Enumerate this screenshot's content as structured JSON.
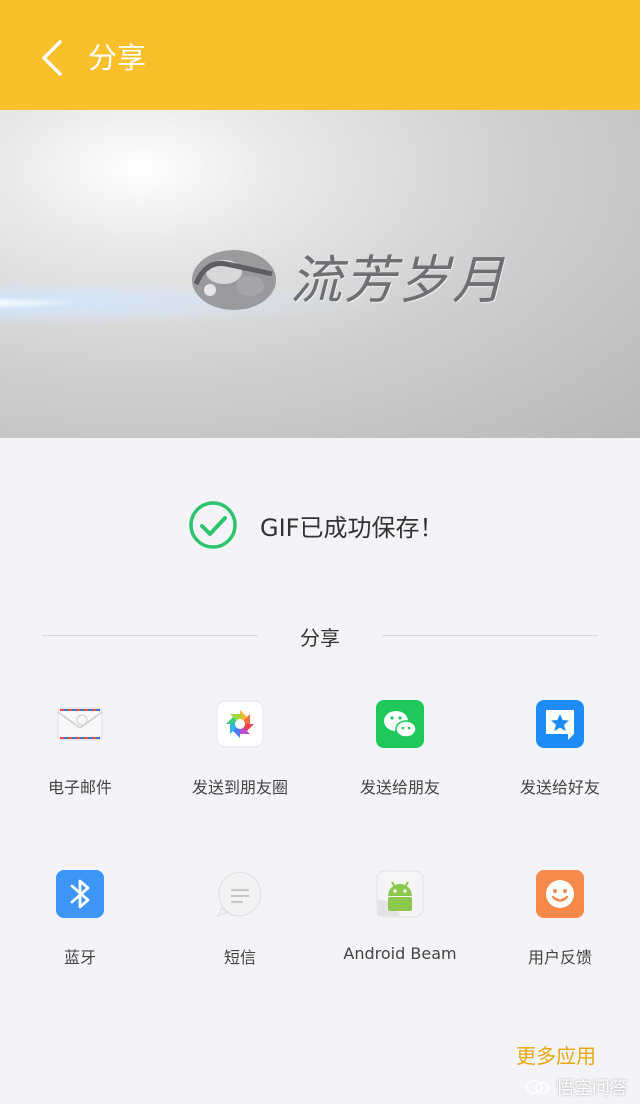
{
  "header": {
    "title": "分享",
    "background": "#f9c02c"
  },
  "preview": {
    "logo_text": "流芳岁月"
  },
  "status": {
    "message": "GIF已成功保存！",
    "check_color": "#2fc46e"
  },
  "share": {
    "section_label": "分享",
    "items": [
      {
        "label": "电子邮件",
        "icon": "envelope-icon"
      },
      {
        "label": "发送到朋友圈",
        "icon": "moments-icon"
      },
      {
        "label": "发送给朋友",
        "icon": "wechat-icon"
      },
      {
        "label": "发送给好友",
        "icon": "qq-icon"
      },
      {
        "label": "蓝牙",
        "icon": "bluetooth-icon"
      },
      {
        "label": "短信",
        "icon": "sms-icon"
      },
      {
        "label": "Android Beam",
        "icon": "android-icon"
      },
      {
        "label": "用户反馈",
        "icon": "feedback-icon"
      }
    ],
    "more_label": "更多应用"
  },
  "watermark": {
    "text": "悟空问答"
  }
}
